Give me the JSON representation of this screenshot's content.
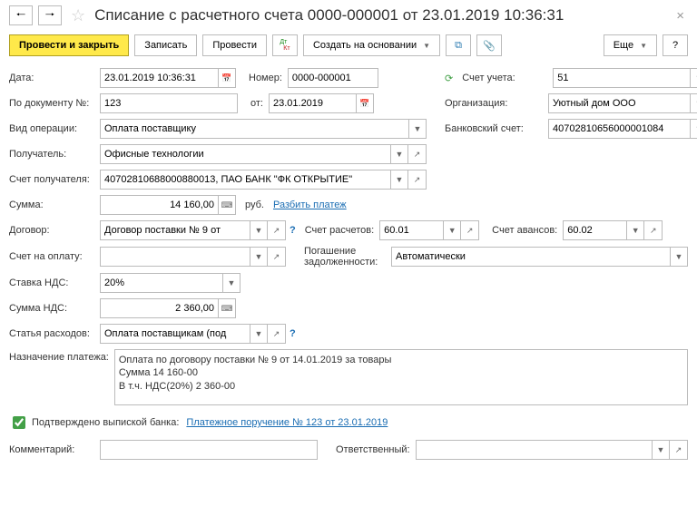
{
  "title": "Списание с расчетного счета 0000-000001 от 23.01.2019 10:36:31",
  "toolbar": {
    "post_close": "Провести и закрыть",
    "save": "Записать",
    "post": "Провести",
    "create_based": "Создать на основании",
    "more": "Еще"
  },
  "labels": {
    "date": "Дата:",
    "number": "Номер:",
    "account": "Счет учета:",
    "doc_no": "По документу №:",
    "from": "от:",
    "organization": "Организация:",
    "operation_type": "Вид операции:",
    "bank_account": "Банковский счет:",
    "recipient": "Получатель:",
    "recipient_account": "Счет получателя:",
    "amount": "Сумма:",
    "currency": "руб.",
    "split_payment": "Разбить платеж",
    "contract": "Договор:",
    "settlement_account": "Счет расчетов:",
    "advance_account": "Счет авансов:",
    "invoice": "Счет на оплату:",
    "debt_repayment": "Погашение задолженности:",
    "vat_rate": "Ставка НДС:",
    "vat_amount": "Сумма НДС:",
    "expense_item": "Статья расходов:",
    "purpose": "Назначение платежа:",
    "confirmed": "Подтверждено выпиской банка:",
    "payment_order": "Платежное поручение № 123 от 23.01.2019",
    "comment": "Комментарий:",
    "responsible": "Ответственный:"
  },
  "values": {
    "date": "23.01.2019 10:36:31",
    "number": "0000-000001",
    "account": "51",
    "doc_no": "123",
    "from_date": "23.01.2019",
    "organization": "Уютный дом ООО",
    "operation_type": "Оплата поставщику",
    "bank_account": "40702810656000001084",
    "recipient": "Офисные технологии",
    "recipient_account": "40702810688000880013, ПАО БАНК \"ФК ОТКРЫТИЕ\"",
    "amount": "14 160,00",
    "contract": "Договор поставки № 9 от",
    "settlement_account": "60.01",
    "advance_account": "60.02",
    "invoice": "",
    "debt_repayment": "Автоматически",
    "vat_rate": "20%",
    "vat_amount": "2 360,00",
    "expense_item": "Оплата поставщикам (под",
    "purpose": "Оплата по договору поставки № 9 от 14.01.2019 за товары\nСумма 14 160-00\nВ т.ч. НДС(20%) 2 360-00",
    "comment": "",
    "responsible": ""
  }
}
